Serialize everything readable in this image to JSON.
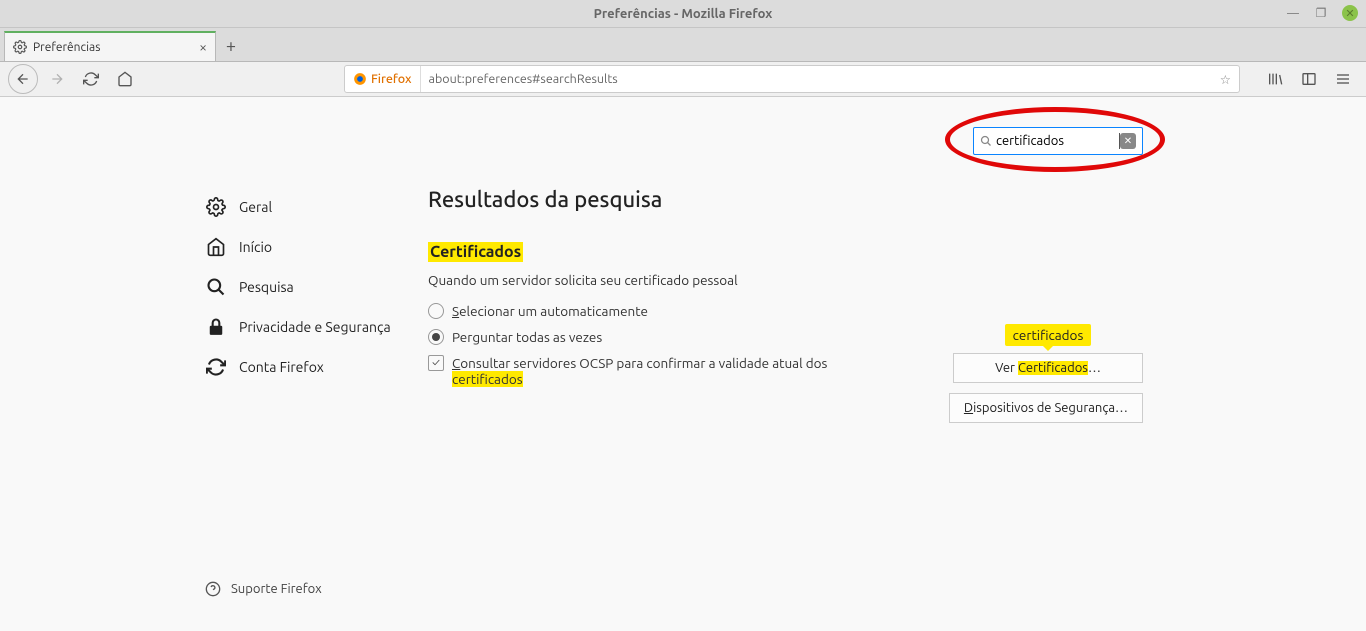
{
  "window": {
    "title": "Preferências - Mozilla Firefox"
  },
  "tab": {
    "label": "Preferências"
  },
  "urlbar": {
    "badge": "Firefox",
    "url": "about:preferences#searchResults"
  },
  "sidebar": {
    "items": [
      {
        "label": "Geral"
      },
      {
        "label": "Início"
      },
      {
        "label": "Pesquisa"
      },
      {
        "label": "Privacidade e Segurança"
      },
      {
        "label": "Conta Firefox"
      }
    ],
    "support": "Suporte Firefox"
  },
  "search": {
    "value": "certificados"
  },
  "main": {
    "heading": "Resultados da pesquisa",
    "section_title": "Certificados",
    "prompt": "Quando um servidor solicita seu certificado pessoal",
    "opt_auto": "elecionar um automaticamente",
    "opt_auto_first": "S",
    "opt_ask": "Perguntar todas as vezes",
    "ocsp_first": "C",
    "ocsp_rest": "onsultar servidores OCSP para confirmar a validade atual dos ",
    "ocsp_hl": "certificados",
    "tooltip": "certificados",
    "btn_view_pre": "Ver ",
    "btn_view_hl": "Certificados",
    "btn_view_suf": "…",
    "btn_devices_first": "D",
    "btn_devices_rest": "ispositivos de Segurança…"
  }
}
